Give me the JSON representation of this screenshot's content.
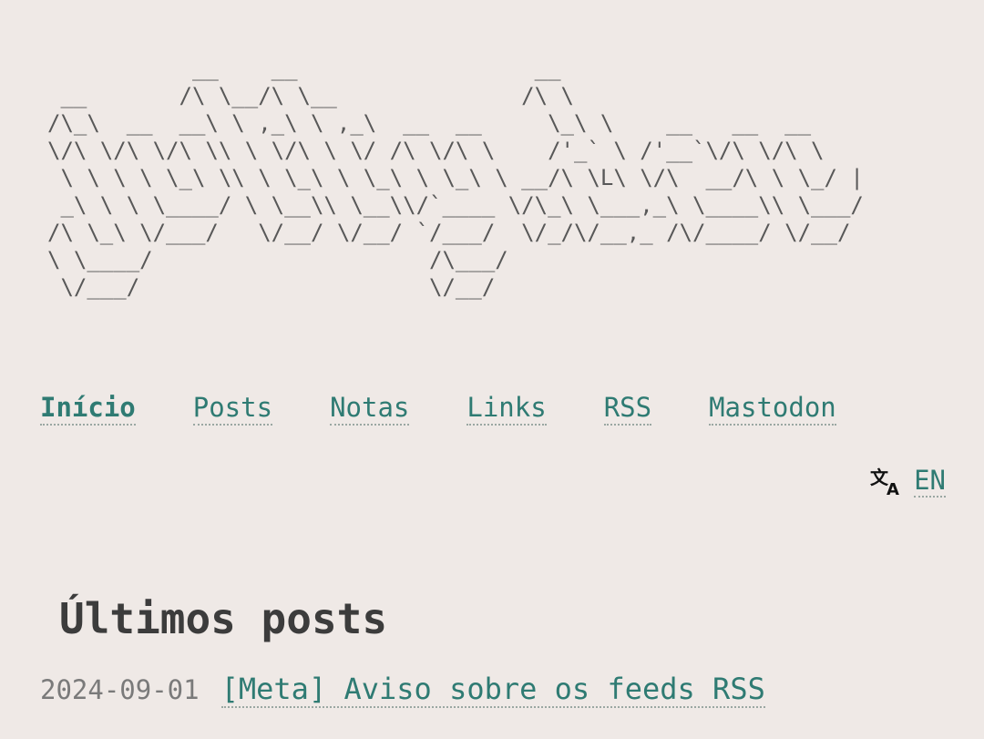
{
  "logo": {
    "ascii": "           __    __                  __\n __       /\\ \\__/\\ \\__              /\\ \\\n/\\_\\  __  __\\ \\ ,_\\ \\ ,_\\  __  __     \\_\\ \\    __   __  __\n\\/\\ \\/\\ \\/\\ \\\\ \\ \\/\\ \\ \\/ /\\ \\/\\ \\    /'_` \\ /'__`\\/\\ \\/\\ \\\n \\ \\ \\ \\ \\_\\ \\\\ \\ \\_\\ \\ \\_\\ \\ \\_\\ \\ __/\\ \\L\\ \\/\\  __/\\ \\ \\_/ |\n _\\ \\ \\ \\____/ \\ \\__\\\\ \\__\\\\/`____ \\/\\_\\ \\___,_\\ \\____\\\\ \\___/\n/\\ \\_\\ \\/___/   \\/__/ \\/__/ `/___/  \\/_/\\/__,_ /\\/____/ \\/__/\n\\ \\____/                     /\\___/\n \\/___/                      \\/__/"
  },
  "nav": {
    "items": [
      {
        "label": "Início",
        "active": true
      },
      {
        "label": "Posts",
        "active": false
      },
      {
        "label": "Notas",
        "active": false
      },
      {
        "label": "Links",
        "active": false
      },
      {
        "label": "RSS",
        "active": false
      },
      {
        "label": "Mastodon",
        "active": false
      }
    ]
  },
  "language": {
    "icon": "translate-icon",
    "label": "EN"
  },
  "section": {
    "title": "Últimos posts"
  },
  "posts": [
    {
      "date": "2024-09-01",
      "title": "[Meta] Aviso sobre os feeds RSS"
    }
  ],
  "colors": {
    "background": "#efe9e6",
    "link": "#2f7b73",
    "active_nav": "#2f4f2f",
    "ascii": "#585858"
  }
}
